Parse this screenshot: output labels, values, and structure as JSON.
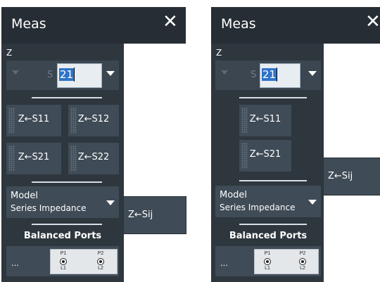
{
  "left": {
    "title": "Meas",
    "close_glyph": "✕",
    "z_label": "Z ←",
    "s_letter": "S",
    "s_value": "21",
    "buttons": [
      "Z←S11",
      "Z←S12",
      "Z←S21",
      "Z←S22"
    ],
    "model_label": "Model",
    "model_value": "Series Impedance",
    "balanced_ports": "Balanced Ports",
    "ellipsis": "...",
    "p1": "P1",
    "p2": "P2",
    "l1": "L1",
    "l2": "L2",
    "sij_button": "Z←Sij"
  },
  "right": {
    "title": "Meas",
    "close_glyph": "✕",
    "z_label": "Z ←",
    "s_letter": "S",
    "s_value": "21",
    "buttons": [
      "Z←S11",
      "Z←S21"
    ],
    "model_label": "Model",
    "model_value": "Series Impedance",
    "balanced_ports": "Balanced Ports",
    "ellipsis": "...",
    "p1": "P1",
    "p2": "P2",
    "l1": "L1",
    "l2": "L2",
    "sij_button": "Z←Sij"
  },
  "colors": {
    "titlebar": "#262d34",
    "panel": "#2e363e",
    "button": "#3f4b56",
    "selection": "#2f73c9"
  }
}
